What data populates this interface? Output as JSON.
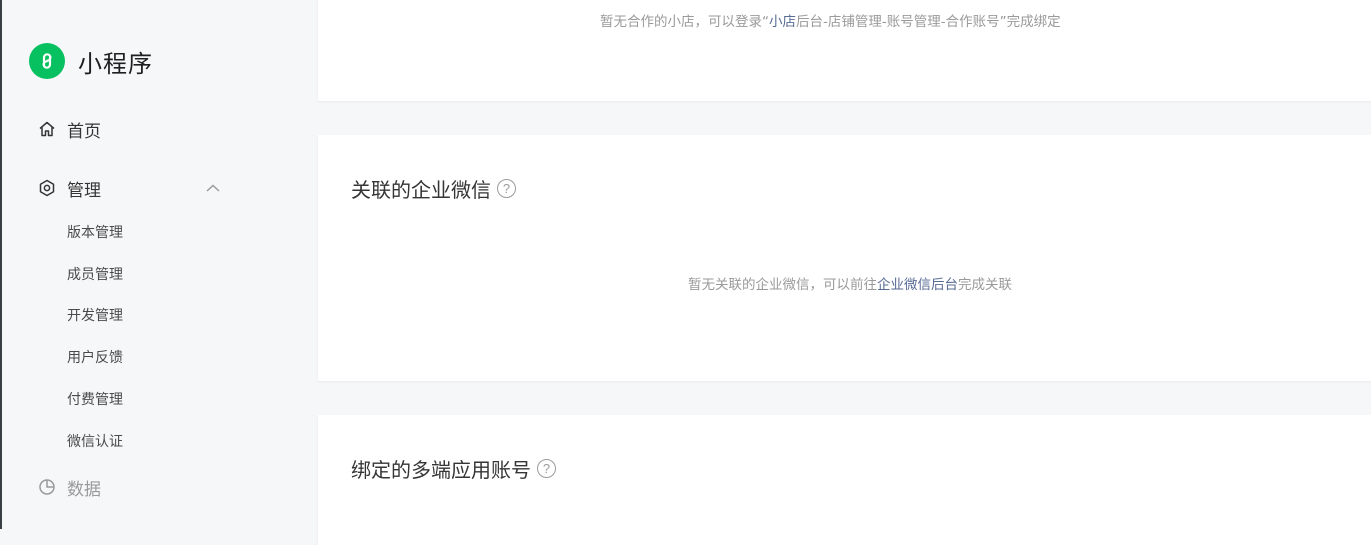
{
  "brand": {
    "name": "小程序"
  },
  "nav": {
    "home": "首页",
    "manage": "管理",
    "data": "数据",
    "manage_sub": [
      "版本管理",
      "成员管理",
      "开发管理",
      "用户反馈",
      "付费管理",
      "微信认证"
    ]
  },
  "shop_card": {
    "tip_prefix": "暂无合作的小店，可以登录“",
    "tip_link": "小店",
    "tip_suffix": "后台-店铺管理-账号管理-合作账号”完成绑定"
  },
  "work_wechat_card": {
    "title": "关联的企业微信",
    "tip_prefix": "暂无关联的企业微信，可以前往",
    "tip_link": "企业微信后台",
    "tip_suffix": "完成关联"
  },
  "multi_app_card": {
    "title": "绑定的多端应用账号"
  },
  "icons": {
    "logo": "mini-program-logo-icon",
    "home": "home-icon",
    "manage": "settings-icon",
    "data": "pie-chart-icon",
    "chevron": "chevron-up-icon",
    "help": "question-circle-icon"
  },
  "colors": {
    "brand_green": "#07c160",
    "link": "#576b95"
  }
}
